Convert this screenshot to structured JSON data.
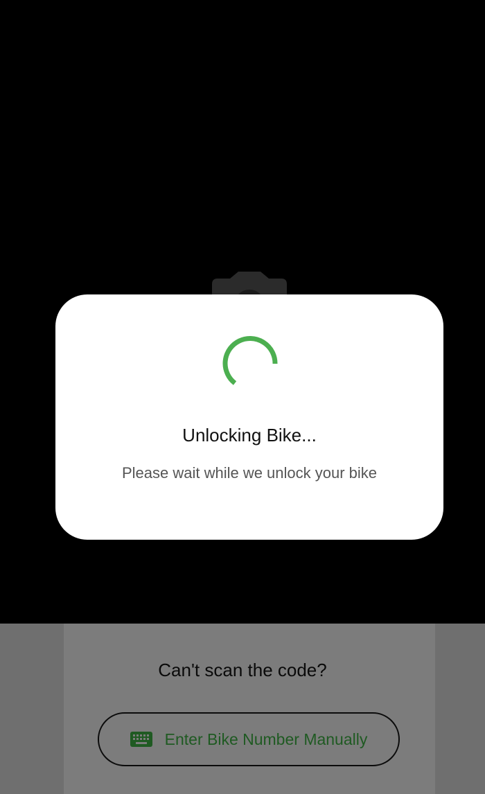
{
  "scanner": {
    "camera_icon": "camera-icon",
    "background_color": "#000000"
  },
  "dialog": {
    "spinner_icon": "loading-spinner-icon",
    "spinner_color": "#4caf50",
    "title": "Unlocking Bike...",
    "message": "Please wait while we unlock your bike"
  },
  "bottom": {
    "prompt": "Can't scan the code?",
    "manual_button": {
      "icon": "keyboard-icon",
      "label": "Enter Bike Number Manually",
      "color": "#1f5a22"
    }
  }
}
